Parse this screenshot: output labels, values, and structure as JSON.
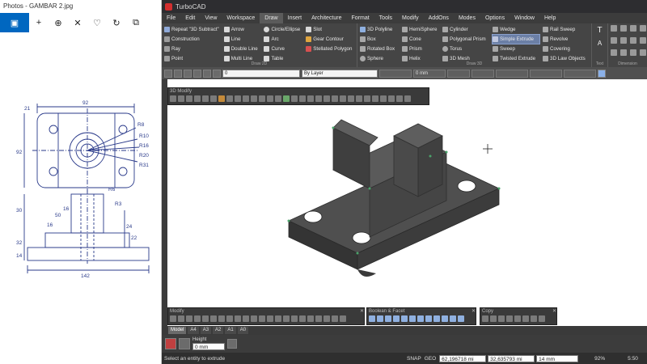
{
  "photos": {
    "title": "Photos - GAMBAR 2.jpg",
    "toolbar": [
      {
        "name": "image-view-icon",
        "glyph": "▣"
      },
      {
        "name": "add-icon",
        "glyph": "+"
      },
      {
        "name": "zoom-icon",
        "glyph": "⊕"
      },
      {
        "name": "delete-icon",
        "glyph": "🗑"
      },
      {
        "name": "favorite-icon",
        "glyph": "♡"
      },
      {
        "name": "rotate-icon",
        "glyph": "↻"
      },
      {
        "name": "crop-icon",
        "glyph": "⧉"
      }
    ],
    "drawing": {
      "dims": {
        "top_width": "92",
        "left_offset": "21",
        "r8": "R8",
        "r10": "R10",
        "r16": "R16",
        "r20": "R20",
        "r31": "R31",
        "height92": "92",
        "dim30": "30",
        "r6": "R6",
        "r3": "R3",
        "dim50": "50",
        "dim16a": "16",
        "dim16b": "16",
        "dim24": "24",
        "dim22": "22",
        "dim32": "32",
        "dim14": "14",
        "bottom_width": "142"
      }
    }
  },
  "tcad": {
    "title": "TurboCAD",
    "menu": [
      "File",
      "Edit",
      "View",
      "Workspace",
      "Draw",
      "Insert",
      "Architecture",
      "Format",
      "Tools",
      "Modify",
      "AddOns",
      "Modes",
      "Options",
      "Window",
      "Help"
    ],
    "active_menu": "Draw",
    "ribbon": {
      "draw2d": {
        "label": "Draw 2D",
        "col1": [
          "Repeat \"3D Subtract\"",
          "Construction",
          "Ray",
          "Point"
        ],
        "col2": [
          "Arrow",
          "Line",
          "Double Line",
          "Multi Line"
        ],
        "col3": [
          "Circle/Ellipse",
          "Arc",
          "Curve",
          "Table"
        ],
        "col4": [
          "Slot",
          "Gear Contour",
          "Stellated Polygon",
          ""
        ]
      },
      "draw3d": {
        "label": "Draw 3D",
        "col1": [
          "3D Polyline",
          "Box",
          "Rotated Box",
          "Sphere"
        ],
        "col2": [
          "HemiSphere",
          "Cone",
          "Prism",
          "Helix"
        ],
        "col3": [
          "Cylinder",
          "Polygonal Prism",
          "Torus",
          "3D Mesh"
        ],
        "col4": [
          "Wedge",
          "Simple Extrude",
          "Sweep",
          "Twisted Extrude"
        ],
        "col5": [
          "Rail Sweep",
          "Revolve",
          "Covering",
          "3D Law Objects"
        ]
      },
      "selected_item": "Simple Extrude",
      "text_label": "Text",
      "dimension_label": "Dimension"
    },
    "propbar": {
      "layer_value": "0",
      "by_layer": "By Layer",
      "thickness": "0 mm"
    },
    "floating": {
      "toolbar_3d_title": "3D Modify",
      "modify_title": "Modify",
      "boolean_title": "Boolean & Facet",
      "copy_title": "Copy"
    },
    "layout_tabs": [
      "Model",
      "A4",
      "A3",
      "A2",
      "A1",
      "A0"
    ],
    "active_tab": "Model",
    "inspector": {
      "label": "Height",
      "value": "0 mm"
    },
    "status": {
      "prompt": "Select an entity to extrude",
      "snap": "SNAP",
      "geo": "GEO",
      "x": "62,196718 mi",
      "y": "32,635793 mi",
      "z": "14 mm",
      "zoom": "92%",
      "time": "5:50"
    }
  },
  "colors": {
    "photos_accent": "#0067c0",
    "cad_dark": "#3b3b3b",
    "part_dark": "#3e3e3e",
    "part_top": "#525252",
    "selection_highlight": "#6b7fa6",
    "drawing_blue": "#2a3a8a"
  }
}
